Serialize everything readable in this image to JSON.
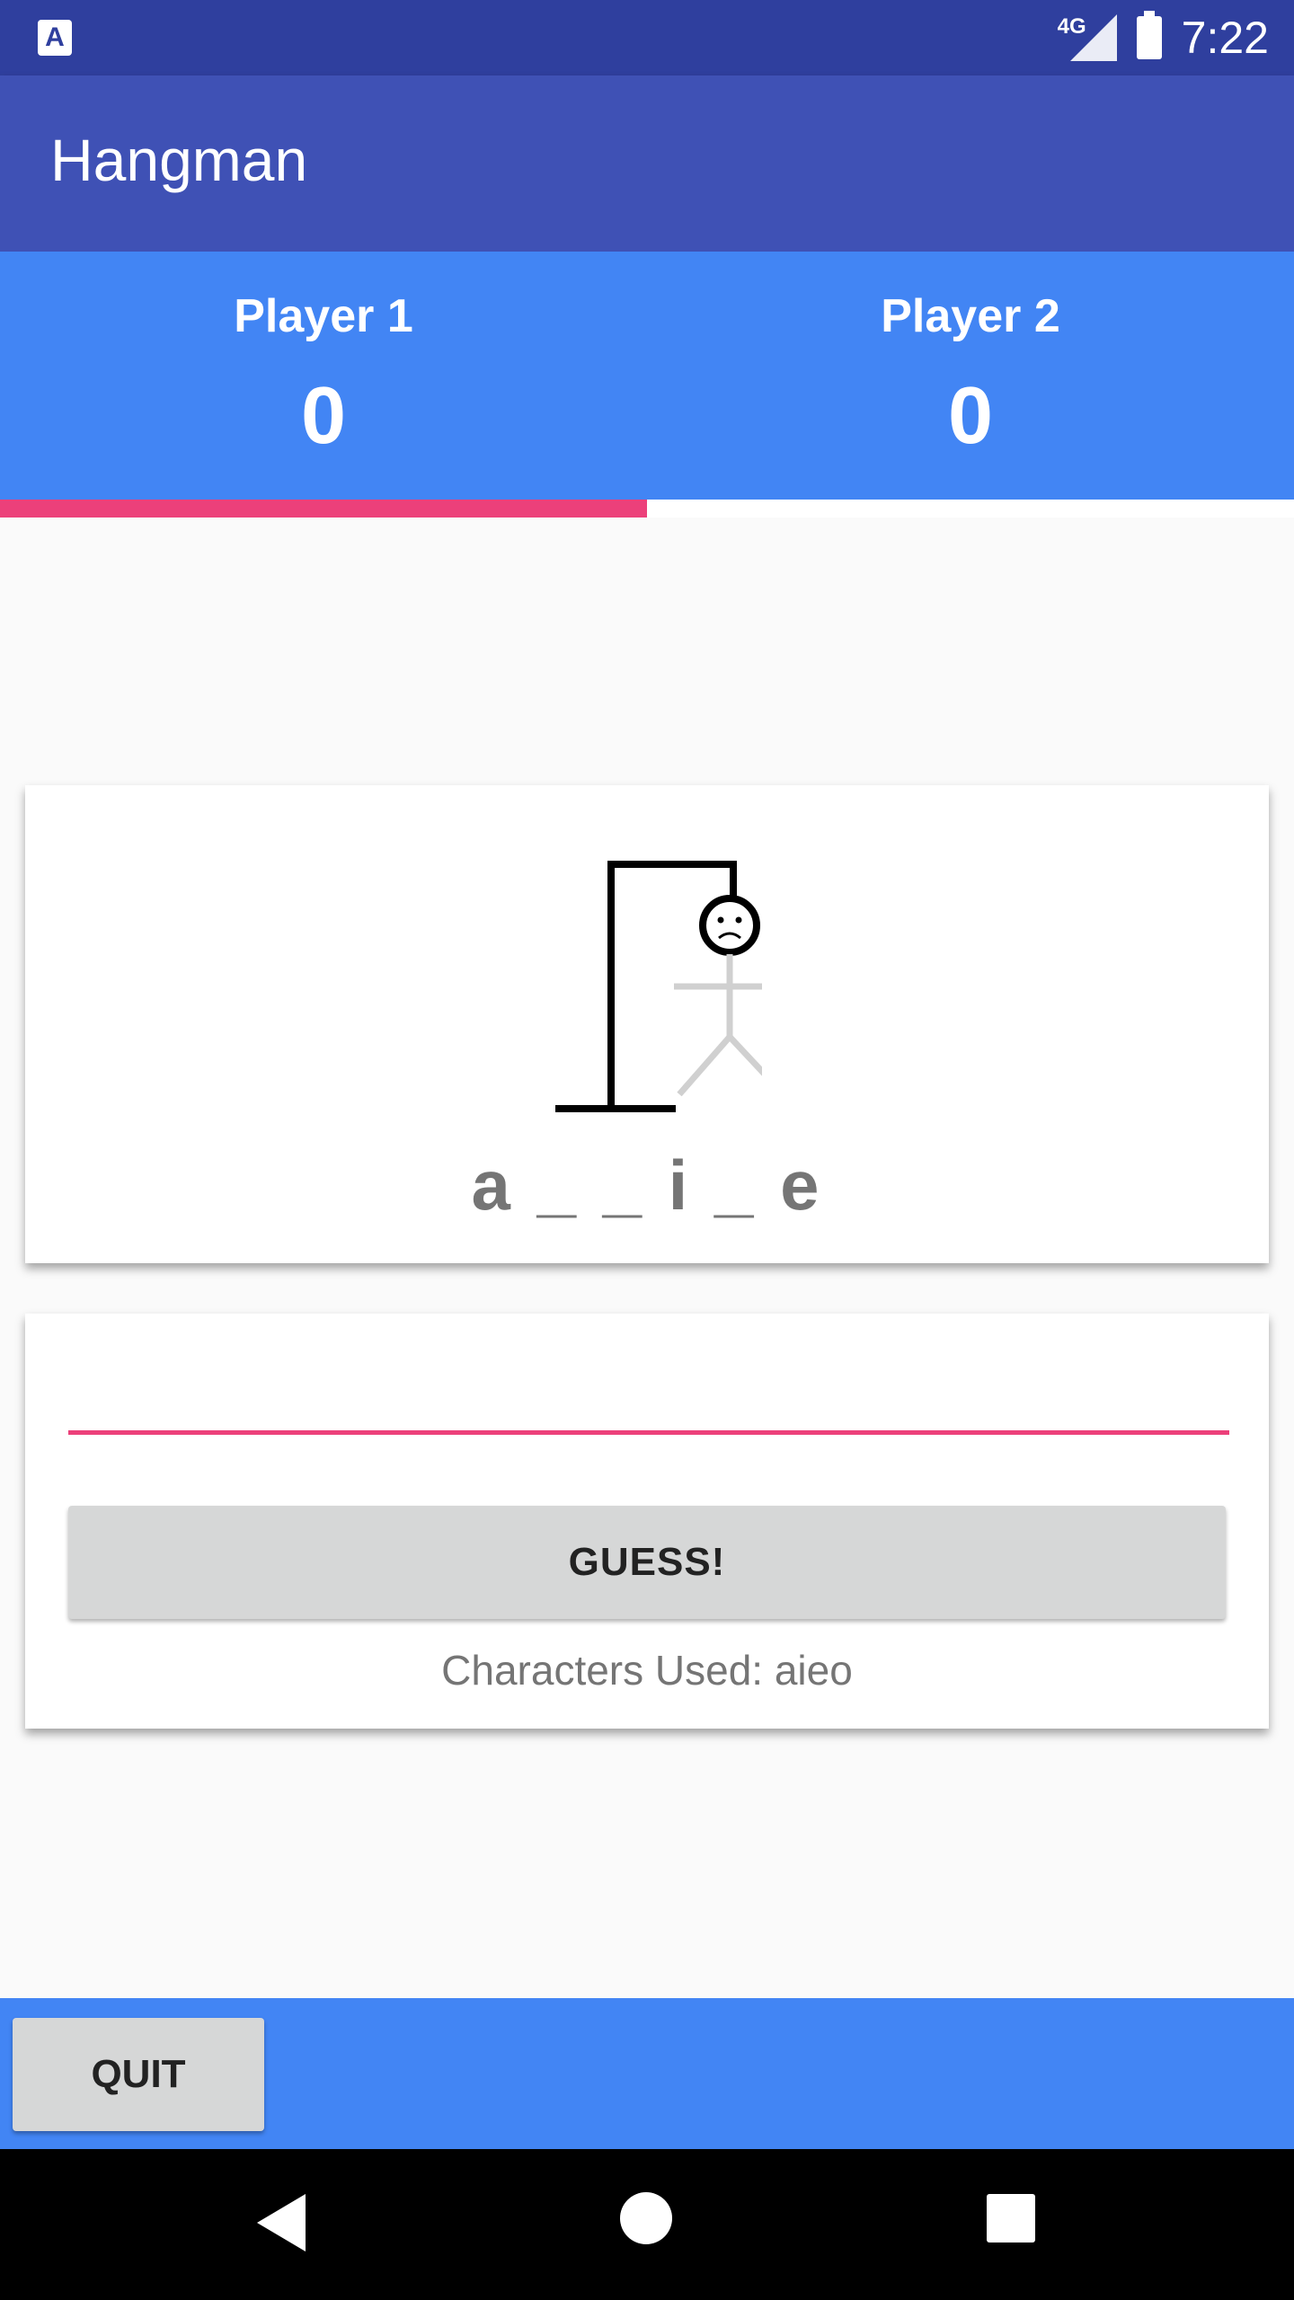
{
  "status_bar": {
    "app_icon": "A",
    "network": "4G",
    "time": "7:22",
    "icons": [
      "app-notification-icon",
      "signal-icon",
      "battery-charging-icon"
    ]
  },
  "app_bar": {
    "title": "Hangman"
  },
  "scoreboard": {
    "players": [
      {
        "name": "Player 1",
        "score": "0"
      },
      {
        "name": "Player 2",
        "score": "0"
      }
    ],
    "active_player": 1,
    "accent_color": "#ec407a"
  },
  "game": {
    "word_display": "a _ _ i _ e",
    "guess_input": {
      "value": "",
      "placeholder": ""
    },
    "guess_button_label": "GUESS!",
    "characters_used": "Characters Used: aieo",
    "hangman_parts_revealed": [
      "head"
    ]
  },
  "bottom_bar": {
    "quit_label": "QUIT"
  },
  "nav": {
    "icons": [
      "back-icon",
      "home-icon",
      "recents-icon"
    ]
  },
  "colors": {
    "status_bar": "#2f3f9e",
    "app_bar": "#3f51b5",
    "primary": "#4285f4",
    "accent": "#ec407a"
  }
}
